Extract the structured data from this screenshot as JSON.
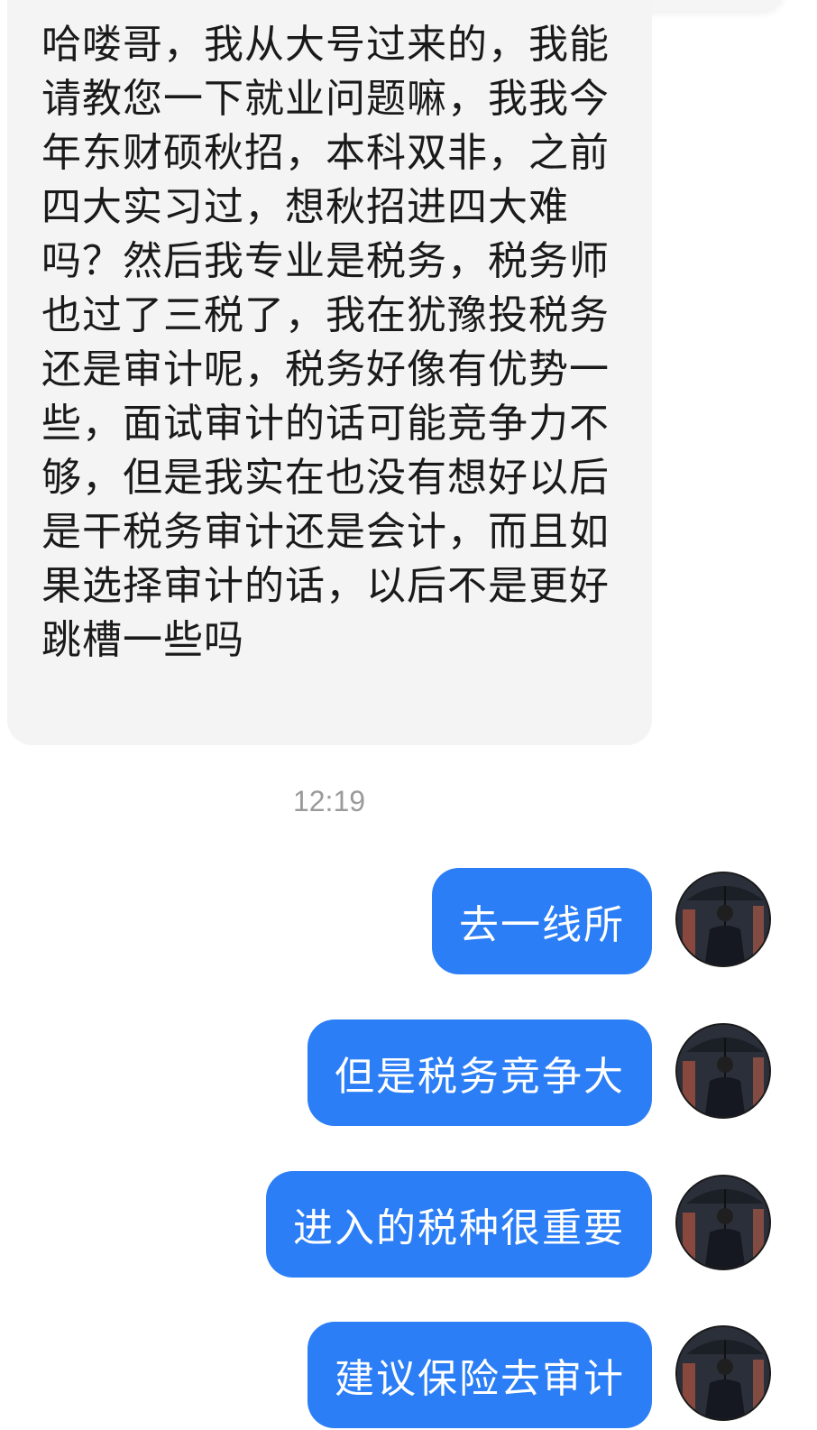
{
  "incoming_message": {
    "text": "哈喽哥，我从大号过来的，我能请教您一下就业问题嘛，我我今年东财硕秋招，本科双非，之前四大实习过，想秋招进四大难吗？然后我专业是税务，税务师也过了三税了，我在犹豫投税务还是审计呢，税务好像有优势一些，面试审计的话可能竞争力不够，但是我实在也没有想好以后是干税务审计还是会计，而且如果选择审计的话，以后不是更好跳槽一些吗"
  },
  "timestamp": "12:19",
  "outgoing_messages": [
    {
      "text": "去一线所"
    },
    {
      "text": "但是税务竞争大"
    },
    {
      "text": "进入的税种很重要"
    },
    {
      "text": "建议保险去审计"
    }
  ],
  "colors": {
    "outgoing_bubble": "#2b7ef5",
    "incoming_bubble": "#f4f4f5",
    "timestamp": "#9a9a9a"
  },
  "icons": {
    "avatar": "avatar-man-with-umbrella"
  }
}
